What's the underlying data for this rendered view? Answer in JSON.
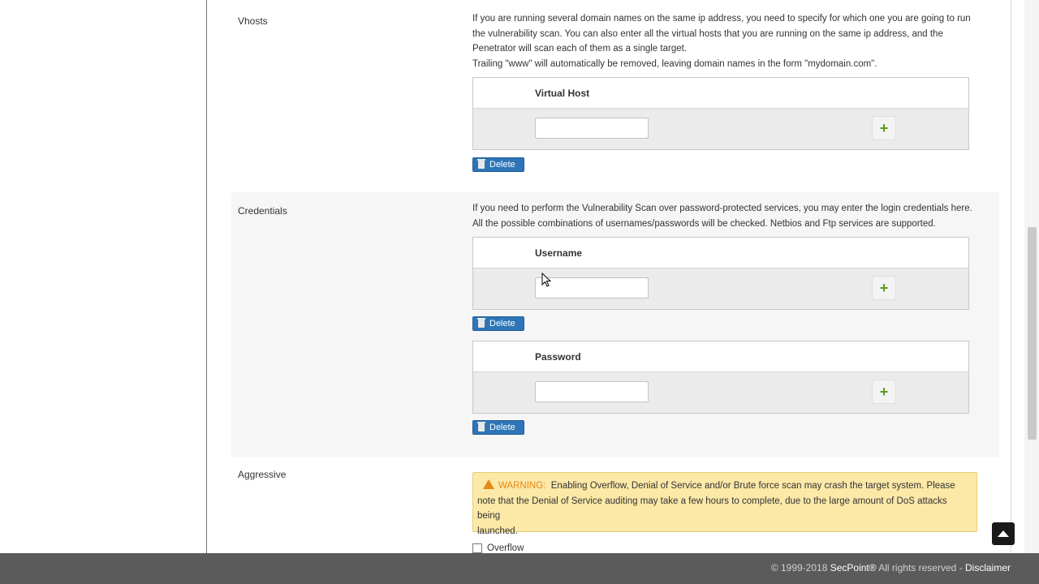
{
  "vhosts": {
    "label": "Vhosts",
    "description_lines": [
      "If you are running several domain names on the same ip address, you need to specify for which one you are going to run",
      "the vulnerability scan. You can also enter all the virtual hosts that you are running on the same ip address, and the",
      "Penetrator will scan each of them as a single target.",
      "Trailing \"www\" will automatically be removed, leaving domain names in the form \"mydomain.com\"."
    ],
    "column_header": "Virtual Host",
    "input_value": "",
    "delete_label": "Delete"
  },
  "credentials": {
    "label": "Credentials",
    "description_lines": [
      "If you need to perform the Vulnerability Scan over password-protected services, you may enter the login credentials here.",
      "All the possible combinations of usernames/passwords will be checked. Netbios and Ftp services are supported."
    ],
    "username_header": "Username",
    "username_value": "",
    "password_header": "Password",
    "password_value": "",
    "delete_label": "Delete"
  },
  "aggressive": {
    "label": "Aggressive",
    "warning_tag": "WARNING:",
    "warning_text_line1": "Enabling Overflow, Denial of Service and/or Brute force scan may crash the target system. Please",
    "warning_text_line2": "note that the Denial of Service auditing may take a few hours to complete, due to the large amount of DoS attacks being",
    "warning_text_line3": "launched.",
    "overflow_label": "Overflow",
    "overflow_checked": false
  },
  "footer": {
    "copyright": "© 1999-2018",
    "brand": "SecPoint®",
    "rights": "All rights reserved -",
    "disclaimer": "Disclaimer"
  },
  "icons": {
    "add": "plus-icon",
    "delete": "trash-icon",
    "warning": "warning-triangle-icon",
    "back_to_top": "arrow-up-icon"
  }
}
